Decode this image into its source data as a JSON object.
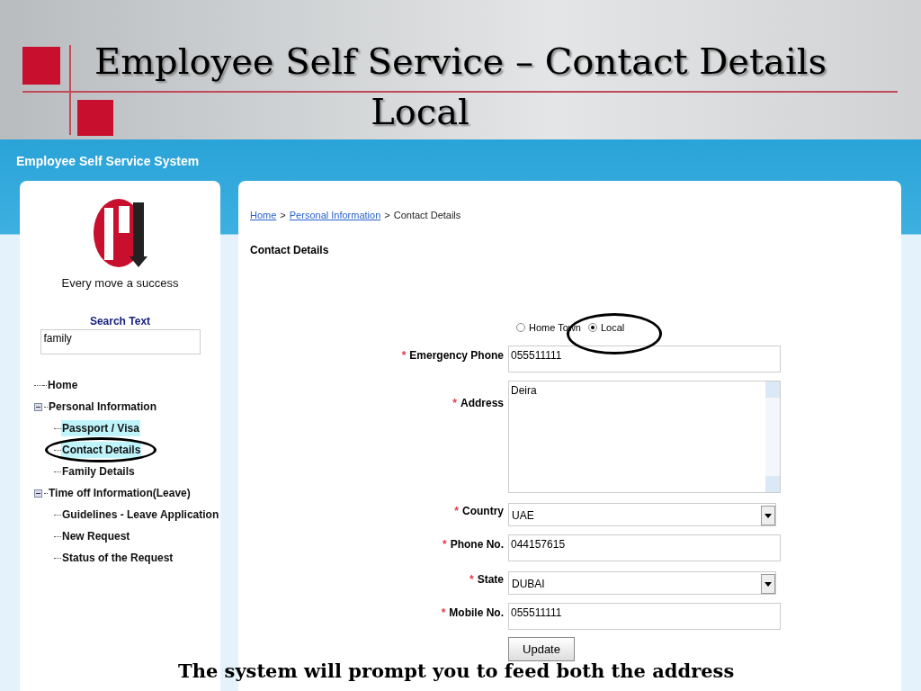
{
  "slide": {
    "title_line_1": "Employee Self Service – Contact Details",
    "title_line_2": "Local",
    "caption": "The system will prompt you to feed both the address"
  },
  "app": {
    "header": "Employee Self Service System",
    "tagline": "Every move a success",
    "search": {
      "label": "Search Text",
      "value": "family"
    },
    "tree": [
      {
        "label": "Home",
        "selected": false
      },
      {
        "label": "Personal Information",
        "selected": false,
        "expanded": true,
        "children": [
          {
            "label": "Passport / Visa",
            "selected": true
          },
          {
            "label": "Contact Details",
            "selected": true
          },
          {
            "label": "Family Details",
            "selected": false
          }
        ]
      },
      {
        "label": "Time off Information(Leave)",
        "selected": false,
        "expanded": true,
        "children": [
          {
            "label": "Guidelines - Leave Application",
            "selected": false
          },
          {
            "label": "New Request",
            "selected": false
          },
          {
            "label": "Status of the Request",
            "selected": false
          }
        ]
      }
    ]
  },
  "content": {
    "breadcrumb": [
      {
        "label": "Home",
        "link": true
      },
      {
        "label": "Personal Information",
        "link": true
      },
      {
        "label": "Contact Details",
        "link": false
      }
    ],
    "breadcrumb_separator": ">",
    "heading": "Contact Details",
    "address_type": [
      {
        "label": "Home Town",
        "selected": false
      },
      {
        "label": "Local",
        "selected": true
      }
    ],
    "fields": [
      {
        "kind": "text",
        "label": "Emergency Phone",
        "value": "055511111"
      },
      {
        "kind": "textarea",
        "label": "Address",
        "value": "Deira"
      },
      {
        "kind": "select",
        "label": "Country",
        "value": "UAE"
      },
      {
        "kind": "text",
        "label": "Phone No.",
        "value": "044157615"
      },
      {
        "kind": "select",
        "label": "State",
        "value": "DUBAI"
      },
      {
        "kind": "text",
        "label": "Mobile No.",
        "value": "055511111"
      }
    ],
    "required_mark": "*",
    "button": "Update"
  }
}
